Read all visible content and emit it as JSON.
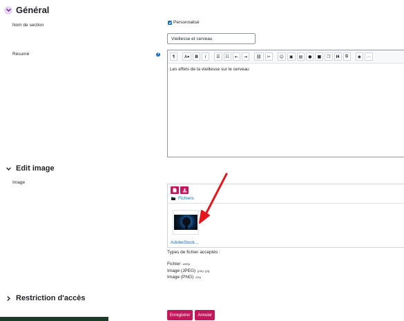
{
  "general": {
    "title": "Général",
    "section_name_label": "Nom de section",
    "custom_checkbox_label": "Personnalisé",
    "section_name_value": "Vieillesse et cerveau",
    "summary_label": "Résumé",
    "summary_text": "Les effets de la vieillesse sur le cerveau"
  },
  "editor_toolbar": {
    "para": "¶",
    "font": "A▾",
    "bold": "B",
    "italic": "I"
  },
  "edit_image": {
    "title": "Edit image",
    "image_label": "Image",
    "folder_label": "Fichiers",
    "file_name": "AdobeStock...",
    "accepted_title": "Types de fichier acceptés :",
    "types": [
      {
        "name": "Fichier",
        "ext": ".webp"
      },
      {
        "name": "Image (JPEG)",
        "ext": ".jpeg .jpg"
      },
      {
        "name": "Image (PNG)",
        "ext": ".png"
      }
    ]
  },
  "restriction": {
    "title": "Restriction d'accès"
  },
  "actions": {
    "save_label": "Enregistrer",
    "cancel_label": "Annuler"
  },
  "colors": {
    "accent": "#c2185b",
    "link": "#0f6cbf",
    "annotation_arrow": "#e8141b"
  }
}
